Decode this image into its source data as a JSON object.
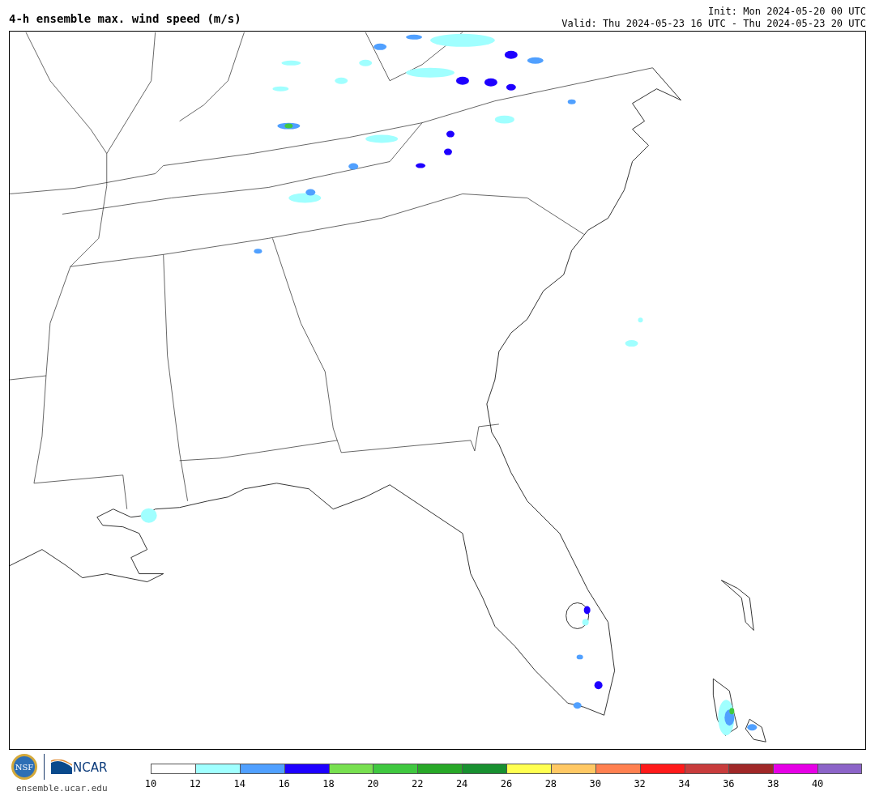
{
  "title": "4-h ensemble max. wind speed (m/s)",
  "init": "Init: Mon 2024-05-20 00 UTC",
  "valid": "Valid: Thu 2024-05-23 16 UTC - Thu 2024-05-23 20 UTC",
  "logos": {
    "nsf_text": "NSF",
    "ncar_text": "NCAR",
    "url": "ensemble.ucar.edu"
  },
  "colorbar": {
    "bins": [
      {
        "color": "#ffffff",
        "label": "10"
      },
      {
        "color": "#a0ffff",
        "label": "12"
      },
      {
        "color": "#50a0ff",
        "label": "14"
      },
      {
        "color": "#1e00ff",
        "label": "16"
      },
      {
        "color": "#78e050",
        "label": "18"
      },
      {
        "color": "#40c840",
        "label": "20"
      },
      {
        "color": "#28a828",
        "label": "22"
      },
      {
        "color": "#189030",
        "label": "24"
      },
      {
        "color": "#ffff50",
        "label": "26"
      },
      {
        "color": "#ffc864",
        "label": "28"
      },
      {
        "color": "#ff8050",
        "label": "30"
      },
      {
        "color": "#ff1a1a",
        "label": "32"
      },
      {
        "color": "#c83c3c",
        "label": "34"
      },
      {
        "color": "#a02828",
        "label": "36"
      },
      {
        "color": "#e600e6",
        "label": "38"
      },
      {
        "color": "#8c64c8",
        "label": "40"
      }
    ]
  }
}
